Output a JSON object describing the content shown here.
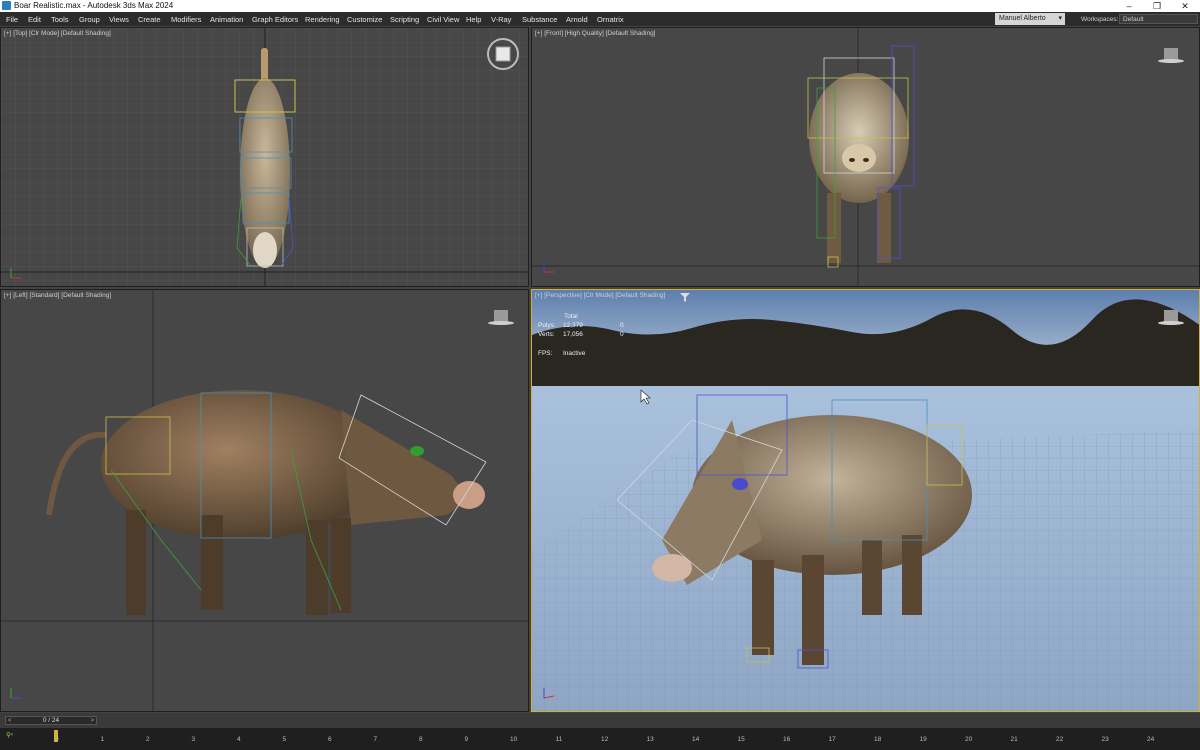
{
  "window": {
    "title": "Boar Realistic.max - Autodesk 3ds Max 2024"
  },
  "menu": [
    "File",
    "Edit",
    "Tools",
    "Group",
    "Views",
    "Create",
    "Modifiers",
    "Animation",
    "Graph Editors",
    "Rendering",
    "Customize",
    "Scripting",
    "Civil View",
    "Help",
    "V-Ray",
    "Substance",
    "Arnold",
    "Ornatrix"
  ],
  "user": {
    "name": "Manuel Alberto"
  },
  "workspace": {
    "label": "Workspaces:",
    "value": "Default"
  },
  "viewports": {
    "top": "[+] [Top] [Clr Mode] [Default Shading]",
    "front": "[+] [Front] [High Quality] [Default Shading]",
    "left": "[+] [Left] [Standard] [Default Shading]",
    "perspective": "[+] [Perspective] [Clr Mode] [Default Shading]"
  },
  "stats": {
    "total_label": "Total",
    "polys_label": "Polys:",
    "polys_total": "12,379",
    "polys_sel": "0",
    "verts_label": "Verts:",
    "verts_total": "17,056",
    "verts_sel": "0",
    "fps_label": "FPS:",
    "fps_value": "Inactive"
  },
  "timeline": {
    "slider": "0 / 24",
    "ticks": [
      "0",
      "1",
      "2",
      "3",
      "4",
      "5",
      "6",
      "7",
      "8",
      "9",
      "10",
      "11",
      "12",
      "13",
      "14",
      "15",
      "16",
      "17",
      "18",
      "19",
      "20",
      "21",
      "22",
      "23",
      "24"
    ]
  },
  "colors": {
    "active_border": "#d4b32c",
    "viewport_bg": "#474747",
    "grid": "#5a5a5a",
    "menubar": "#2c2c2c"
  }
}
